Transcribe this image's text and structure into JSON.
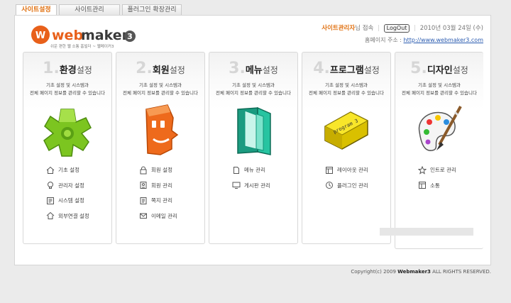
{
  "tabs": [
    {
      "label": "사이트설정"
    },
    {
      "label": "사이트관리"
    },
    {
      "label": "플러그인 확장관리"
    }
  ],
  "logo": {
    "name": "webmaker3",
    "tagline": "쉬운 편한 웹 소통 홈빌더 ~ 웹메이커3"
  },
  "header": {
    "admin_name": "사이트관리자",
    "login_suffix": "님 접속",
    "logout_label": "LogOut",
    "date": "2010년 03월 24일 (수)",
    "homepage_label": "홈페이지 주소 :",
    "homepage_url": "http://www.webmaker3.com"
  },
  "cards": [
    {
      "num": "1.",
      "t1": "환경",
      "t2": "설정",
      "desc1": "기초 설정 및 시스템과",
      "desc2": "전체 페이지 정보를 관리할 수 있습니다",
      "icon": "green-gear-icon",
      "links": [
        {
          "label": "기초 설정",
          "icon": "home-icon"
        },
        {
          "label": "관리자 설정",
          "icon": "lightbulb-icon"
        },
        {
          "label": "시스템 설정",
          "icon": "system-icon"
        },
        {
          "label": "외부연결 설정",
          "icon": "external-home-icon"
        }
      ]
    },
    {
      "num": "2.",
      "t1": "회원",
      "t2": "설정",
      "desc1": "기초 설정 및 시스템과",
      "desc2": "전체 페이지 정보를 관리할 수 있습니다",
      "icon": "orange-face-icon",
      "links": [
        {
          "label": "회원 설정",
          "icon": "lock-icon"
        },
        {
          "label": "회원 관리",
          "icon": "id-card-icon"
        },
        {
          "label": "쪽지 관리",
          "icon": "note-icon"
        },
        {
          "label": "이메일 관리",
          "icon": "mail-icon"
        }
      ]
    },
    {
      "num": "3.",
      "t1": "메뉴",
      "t2": "설정",
      "desc1": "기초 설정 및 시스템과",
      "desc2": "전체 페이지 정보를 관리할 수 있습니다",
      "icon": "teal-folder-icon",
      "links": [
        {
          "label": "메뉴 관리",
          "icon": "document-icon"
        },
        {
          "label": "게시판 관리",
          "icon": "monitor-icon"
        }
      ]
    },
    {
      "num": "4.",
      "t1": "프로그램",
      "t2": "설정",
      "desc1": "기초 설정 및 시스템과",
      "desc2": "전체 페이지 정보를 관리할 수 있습니다",
      "icon": "yellow-program-key-icon",
      "links": [
        {
          "label": "레이아웃 관리",
          "icon": "layout-icon"
        },
        {
          "label": "플러그인 관리",
          "icon": "plugin-icon"
        }
      ]
    },
    {
      "num": "5.",
      "t1": "디자인",
      "t2": "설정",
      "desc1": "기초 설정 및 시스템과",
      "desc2": "전체 페이지 정보를 관리할 수 있습니다",
      "icon": "palette-icon",
      "links": [
        {
          "label": "인트로 관리",
          "icon": "star-icon"
        },
        {
          "label": "소통",
          "icon": "window-icon"
        }
      ]
    }
  ],
  "footer": {
    "prefix": "Copyright(c) 2009 ",
    "brand": "Webmaker3",
    "suffix": " ALL RIGHTS RESERVED."
  }
}
